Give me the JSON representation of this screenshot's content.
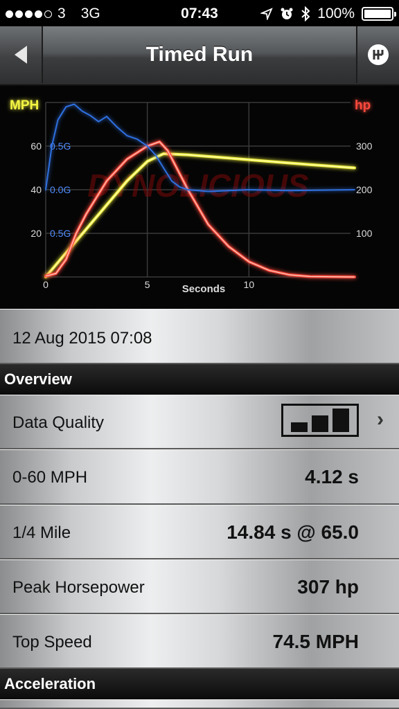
{
  "status": {
    "carrier": "3",
    "network": "3G",
    "time": "07:43",
    "battery": "100%",
    "signal_bars": 4,
    "signal_total": 5,
    "icons": [
      "location-icon",
      "alarm-icon",
      "bluetooth-icon"
    ]
  },
  "nav": {
    "title": "Timed Run",
    "back_icon": "back-arrow-icon",
    "right_icon": "gear-shift-icon"
  },
  "chart_data": {
    "type": "line",
    "xlabel": "Seconds",
    "ylabel_left": "MPH",
    "ylabel_right": "hp",
    "x_ticks": [
      "0",
      "5",
      "10"
    ],
    "y_left_ticks": [
      "20",
      "40",
      "60"
    ],
    "y_right_ticks": [
      "100",
      "200",
      "300"
    ],
    "g_ticks": [
      "0.5G",
      "0.0G",
      "0.5G"
    ],
    "xlim": [
      0,
      15
    ],
    "ylim_left": [
      0,
      80
    ],
    "ylim_right": [
      0,
      400
    ],
    "watermark": "DYNOLICIOUS",
    "colors": {
      "speed": "#f4f542",
      "hp": "#ff4a3d",
      "g": "#2f6fe0"
    },
    "series": [
      {
        "key": "speed",
        "x": [
          0,
          1,
          2,
          3,
          4,
          5,
          5.8,
          7,
          9,
          11,
          13,
          15.2
        ],
        "y": [
          0,
          11,
          22,
          33,
          44,
          53,
          56.5,
          56,
          54.5,
          53,
          51.5,
          50
        ]
      },
      {
        "key": "hp",
        "x": [
          0,
          0.5,
          1,
          1.5,
          2,
          3,
          4,
          5,
          5.6,
          6,
          7,
          8,
          9,
          10,
          11,
          12,
          13,
          15.2
        ],
        "y": [
          2,
          8,
          40,
          100,
          145,
          220,
          270,
          300,
          310,
          290,
          200,
          120,
          70,
          35,
          15,
          5,
          1,
          0
        ]
      },
      {
        "key": "g",
        "x": [
          0,
          0.3,
          0.6,
          1,
          1.4,
          1.8,
          2.2,
          2.6,
          3,
          3.5,
          4,
          4.5,
          5,
          5.4,
          5.8,
          6.2,
          6.6,
          7,
          8,
          10,
          12,
          15.2
        ],
        "y": [
          0.0,
          0.5,
          0.8,
          0.95,
          0.98,
          0.9,
          0.85,
          0.78,
          0.84,
          0.72,
          0.62,
          0.58,
          0.5,
          0.4,
          0.25,
          0.1,
          0.03,
          0.0,
          -0.02,
          0.0,
          -0.01,
          0.0
        ]
      }
    ]
  },
  "date_row": {
    "label": "12 Aug 2015 07:08"
  },
  "sections": {
    "overview": "Overview",
    "acceleration": "Acceleration"
  },
  "rows": {
    "quality": {
      "label": "Data Quality",
      "icon": "signal-bars-icon"
    },
    "zero60": {
      "label": "0-60 MPH",
      "value": "4.12 s"
    },
    "quarter": {
      "label": "1/4 Mile",
      "value": "14.84 s @ 65.0"
    },
    "peak_hp": {
      "label": "Peak Horsepower",
      "value": "307 hp"
    },
    "top_speed": {
      "label": "Top Speed",
      "value": "74.5 MPH"
    }
  }
}
